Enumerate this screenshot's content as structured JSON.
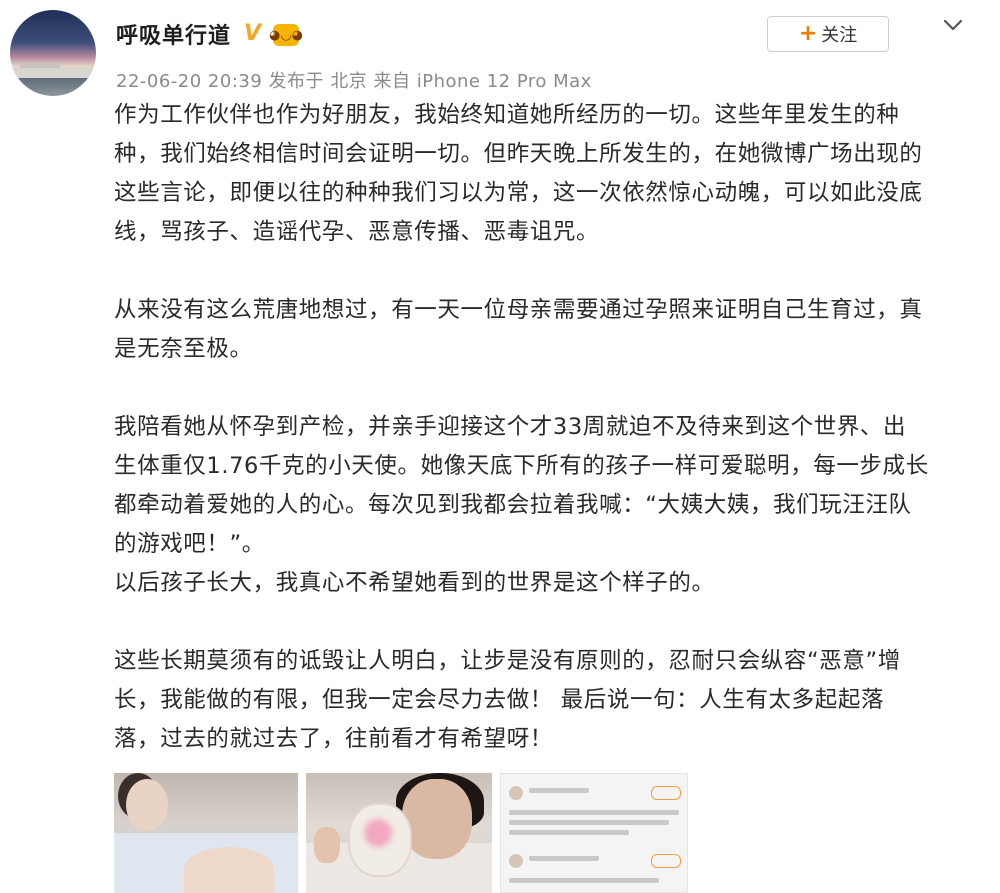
{
  "user": {
    "name": "呼吸单行道",
    "verified_mark": "V",
    "badge_icon": "orange-emoji-badge-icon"
  },
  "meta": {
    "timestamp": "22-06-20 20:39",
    "location_text": "发布于 北京",
    "device_text": "来自 iPhone 12 Pro Max"
  },
  "actions": {
    "follow_plus": "+",
    "follow_label": "关注",
    "more_icon": "chevron-down-icon"
  },
  "post": {
    "p1_lines": [
      "作为工作伙伴也作为好朋友，我始终知道她所经历的一切。这些年里发生的种",
      "种，我们始终相信时间会证明一切。但昨天晚上所发生的，在她微博广场出现的",
      "这些言论，即便以往的种种我们习以为常，这一次依然惊心动魄，可以如此没底",
      "线，骂孩子、造谣代孕、恶意传播、恶毒诅咒。"
    ],
    "p2_lines": [
      "从来没有这么荒唐地想过，有一天一位母亲需要通过孕照来证明自己生育过，真",
      "是无奈至极。"
    ],
    "p3_lines": [
      "我陪看她从怀孕到产检，并亲手迎接这个才33周就迫不及待来到这个世界、出",
      "生体重仅1.76千克的小天使。她像天底下所有的孩子一样可爱聪明，每一步成长",
      "都牵动着爱她的人的心。每次见到我都会拉着我喊：“大姨大姨，我们玩汪汪队",
      "的游戏吧！”。",
      "以后孩子长大，我真心不希望她看到的世界是这个样子的。"
    ],
    "p4_lines": [
      "这些长期莫须有的诋毁让人明白，让步是没有原则的，忍耐只会纵容“恶意”增",
      "长，我能做的有限，但我一定会尽力去做！ 最后说一句：人生有太多起起落",
      "落，过去的就过去了，往前看才有希望呀！"
    ]
  },
  "images": [
    "hospital-photo",
    "mother-baby-photo",
    "comment-screenshot-photo"
  ],
  "colors": {
    "accent_orange": "#f07d00",
    "verified_gold": "#f5a623",
    "meta_gray": "#8a8a8a"
  }
}
